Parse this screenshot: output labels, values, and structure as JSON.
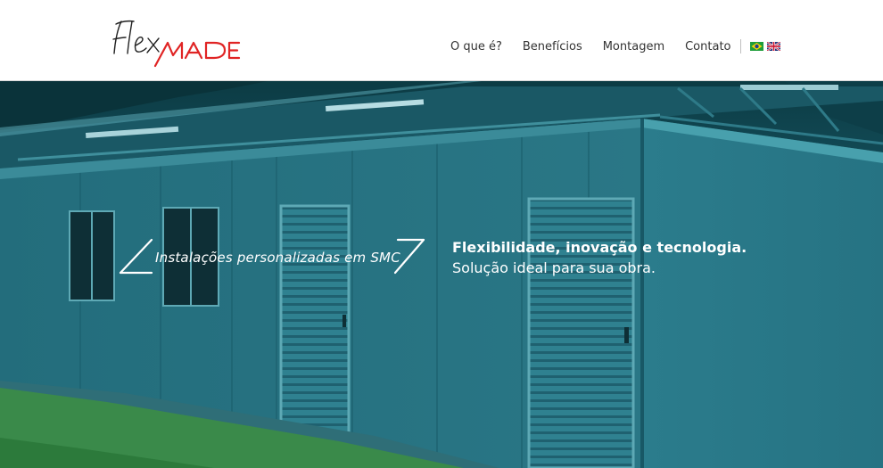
{
  "brand": {
    "logo_text": "FlexMADE",
    "logo_part1": "Flex",
    "logo_part2": "MADE",
    "accent_color": "#e02424"
  },
  "nav": {
    "items": [
      {
        "label": "O que é?"
      },
      {
        "label": "Benefícios"
      },
      {
        "label": "Montagem"
      },
      {
        "label": "Contato"
      }
    ],
    "languages": [
      {
        "icon": "brazil-flag-icon"
      },
      {
        "icon": "uk-flag-icon"
      }
    ]
  },
  "hero": {
    "tagline": "Instalações personalizadas em SMC",
    "headline": "Flexibilidade, inovação e tecnologia.",
    "subline": "Solução ideal para sua obra.",
    "overlay_color": "#1f6576"
  }
}
